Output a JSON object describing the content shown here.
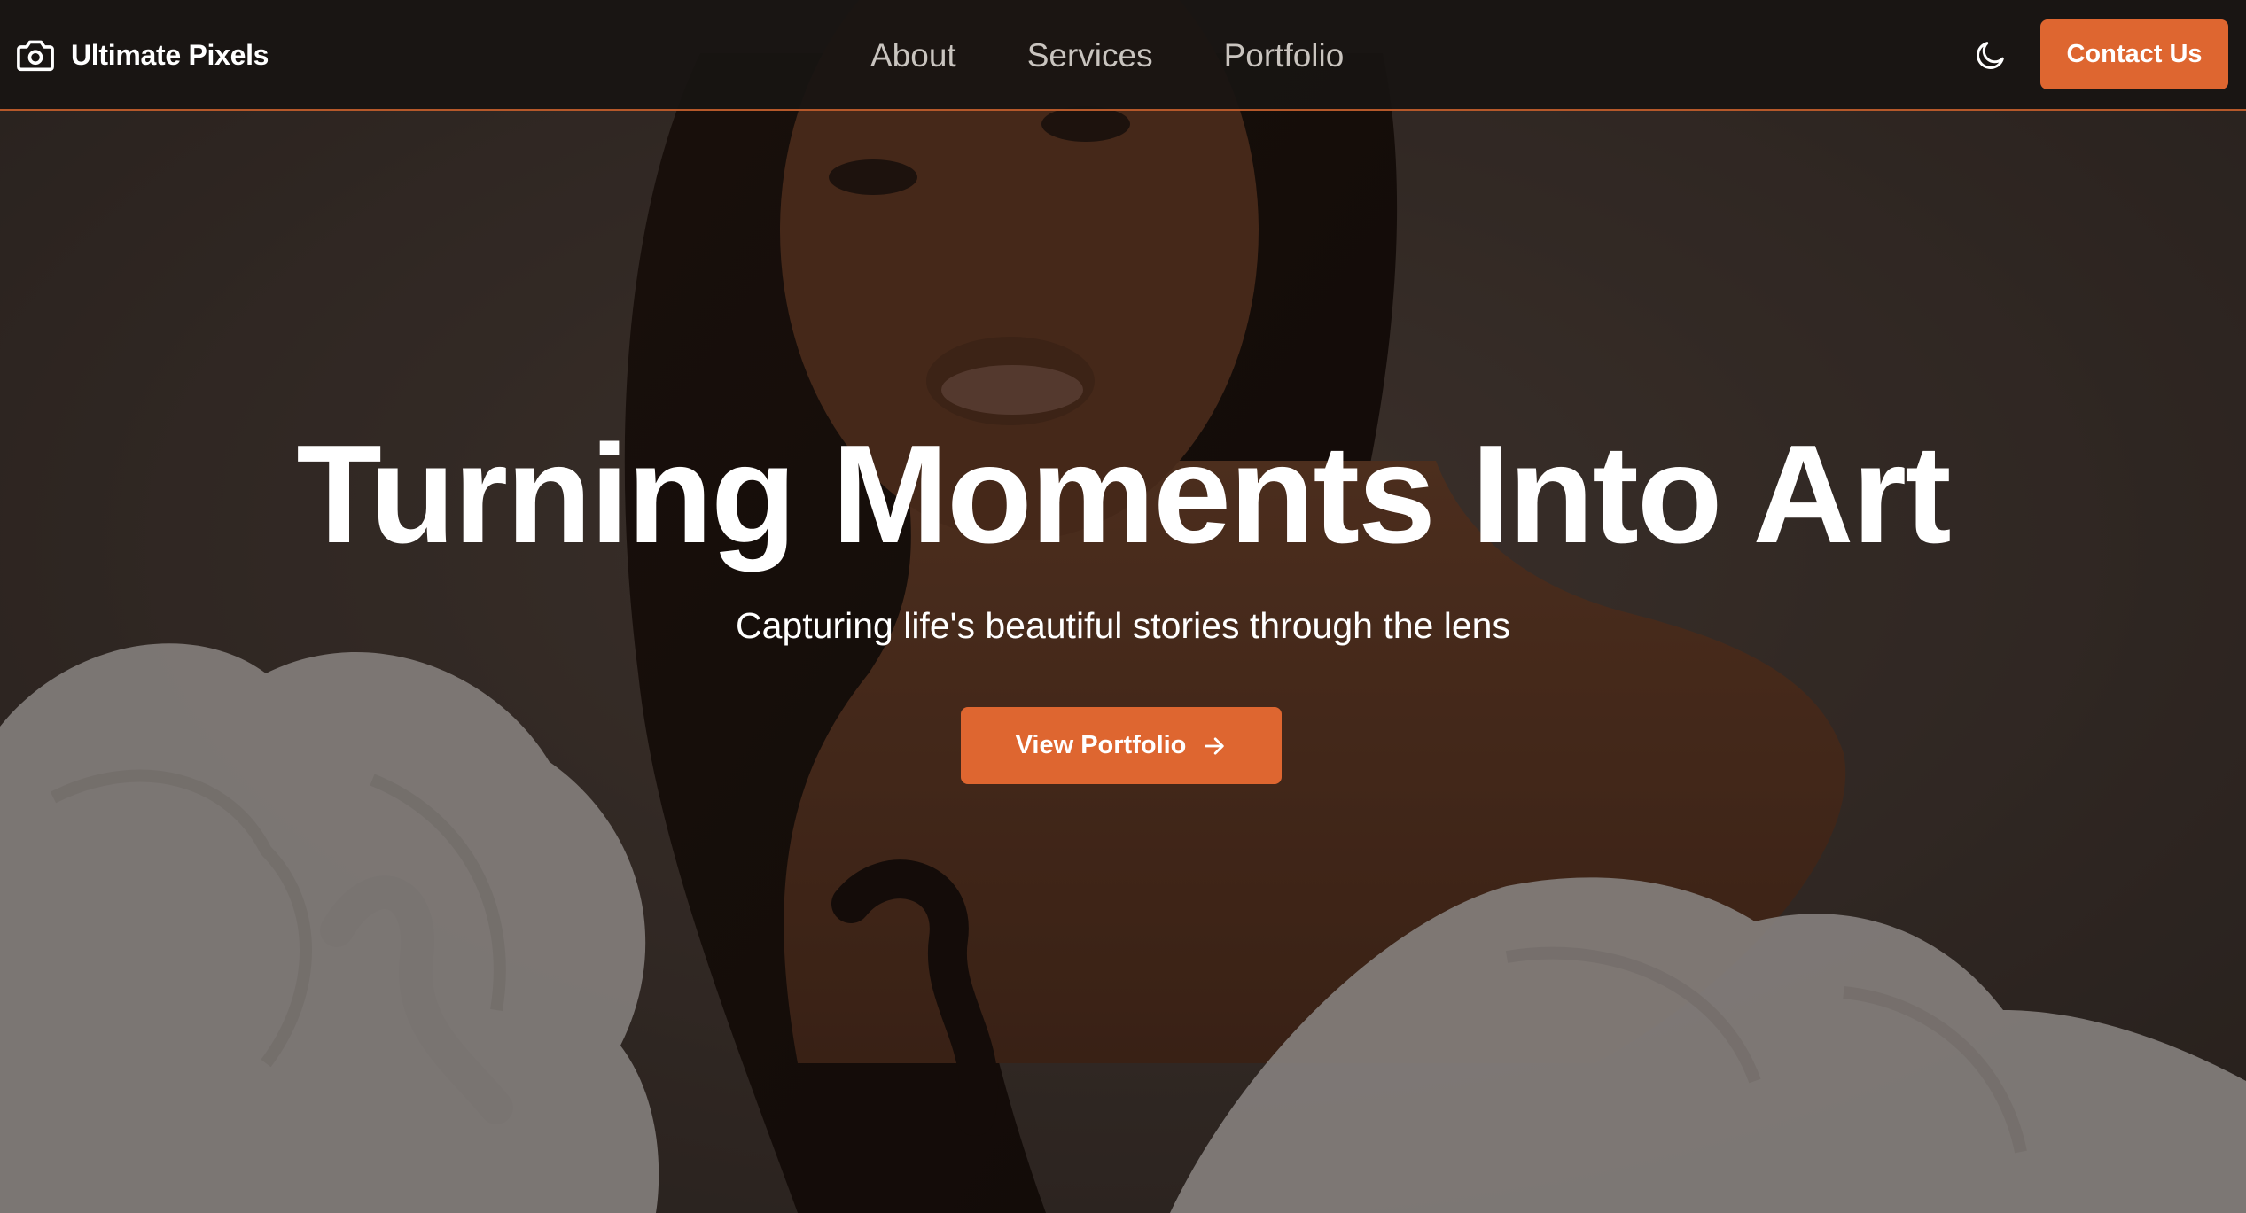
{
  "header": {
    "brand_name": "Ultimate Pixels",
    "brand_icon": "camera-icon",
    "nav": [
      {
        "label": "About"
      },
      {
        "label": "Services"
      },
      {
        "label": "Portfolio"
      }
    ],
    "theme_toggle_icon": "moon-icon",
    "contact_label": "Contact Us"
  },
  "hero": {
    "title": "Turning Moments Into Art",
    "subtitle": "Capturing life's beautiful stories through the lens",
    "cta_label": "View Portfolio",
    "cta_icon": "arrow-right-icon"
  },
  "colors": {
    "accent": "#de6630",
    "header_bg": "#181412",
    "header_border": "#b5582a",
    "nav_text": "#c9c4bf",
    "text": "#ffffff"
  }
}
